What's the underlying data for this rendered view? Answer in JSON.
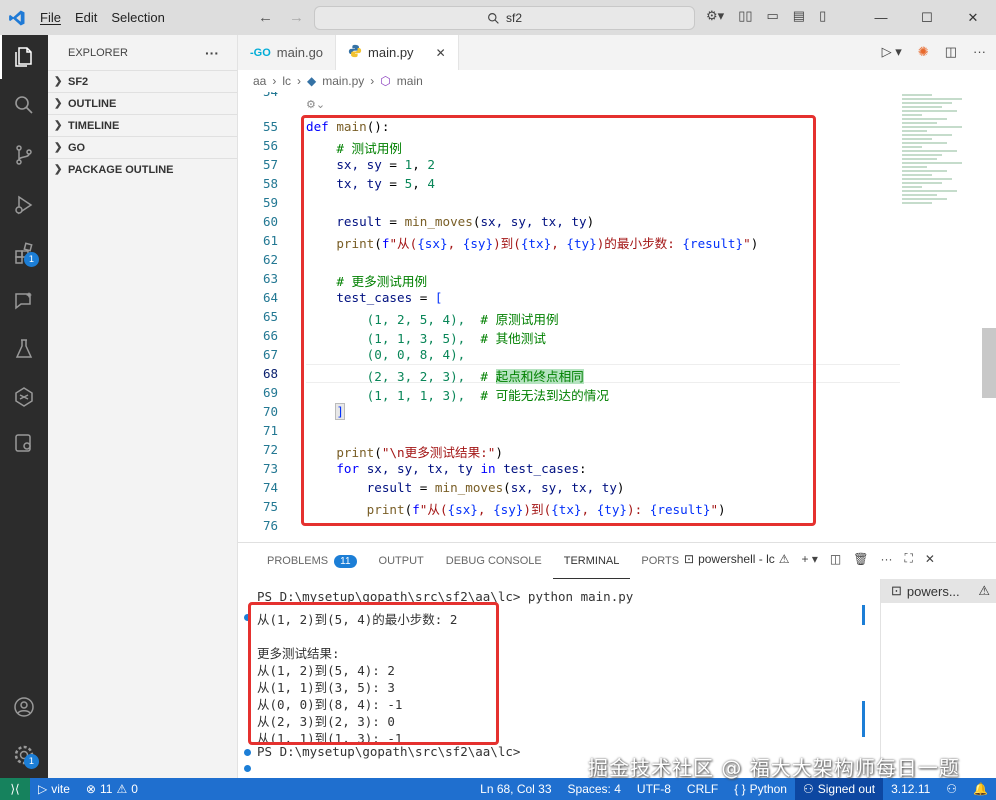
{
  "titlebar": {
    "menu": [
      "File",
      "Edit",
      "Selection"
    ],
    "search_text": "sf2",
    "nav_back": "←",
    "nav_forward": "→"
  },
  "sidebar": {
    "title": "EXPLORER",
    "more": "···",
    "sections": [
      "SF2",
      "OUTLINE",
      "TIMELINE",
      "GO",
      "PACKAGE OUTLINE"
    ]
  },
  "activity_badges": {
    "extensions": "1",
    "settings": "1"
  },
  "tabs": [
    {
      "label": "main.go",
      "icon": "go-file-icon"
    },
    {
      "label": "main.py",
      "icon": "python-file-icon"
    }
  ],
  "breadcrumb": [
    "aa",
    "lc",
    "main.py",
    "main"
  ],
  "editor": {
    "first_line_partial": "54",
    "line_numbers": [
      "55",
      "56",
      "57",
      "58",
      "59",
      "60",
      "61",
      "62",
      "63",
      "64",
      "65",
      "66",
      "67",
      "68",
      "69",
      "70",
      "71",
      "72",
      "73",
      "74",
      "75",
      "76"
    ],
    "current_line": "68",
    "code": {
      "l55_kw": "def",
      "l55_fn": "main",
      "l55_rest": "():",
      "l56": "# 测试用例",
      "l57_vars": "sx, sy",
      "l57_eq": " = ",
      "l57_n1": "1",
      "l57_n2": "2",
      "l58_vars": "tx, ty",
      "l58_n1": "5",
      "l58_n2": "4",
      "l60_var": "result",
      "l60_fn": "min_moves",
      "l60_args": "sx, sy, tx, ty",
      "l61_fn": "print",
      "l61_fstr_prefix": "f",
      "l61_s1": "\"从(",
      "l61_v1": "{sx}",
      "l61_s2": ", ",
      "l61_v2": "{sy}",
      "l61_s3": ")到(",
      "l61_v3": "{tx}",
      "l61_v4": "{ty}",
      "l61_s4": ")的最小步数: ",
      "l61_v5": "{result}",
      "l61_s5": "\"",
      "l63": "# 更多测试用例",
      "l64_var": "test_cases",
      "l65_tuple": "(1, 2, 5, 4),",
      "l65_cm": "# 原测试用例",
      "l66_tuple": "(1, 1, 3, 5),",
      "l66_cm": "# 其他测试",
      "l67_tuple": "(0, 0, 8, 4),",
      "l68_tuple": "(2, 3, 2, 3),",
      "l68_cm_pre": "# ",
      "l68_cm_hl": "起点和终点相同",
      "l69_tuple": "(1, 1, 1, 3),",
      "l69_cm": "# 可能无法到达的情况",
      "l70": "]",
      "l72_fn": "print",
      "l72_str": "\"\\n更多测试结果:\"",
      "l73_kw1": "for",
      "l73_vars": "sx, sy, tx, ty",
      "l73_kw2": "in",
      "l73_iter": "test_cases",
      "l74_var": "result",
      "l74_fn": "min_moves",
      "l74_args": "sx, sy, tx, ty",
      "l75_fn": "print",
      "l75_s3": ")到(",
      "l75_s4": "): "
    }
  },
  "panel": {
    "tabs": [
      "PROBLEMS",
      "OUTPUT",
      "DEBUG CONSOLE",
      "TERMINAL",
      "PORTS"
    ],
    "problems_count": "11",
    "shell_label": "powershell - lc",
    "terminal_list_item": "powers...",
    "terminal_lines": [
      "PS D:\\mysetup\\gopath\\src\\sf2\\aa\\lc> python main.py",
      "从(1, 2)到(5, 4)的最小步数: 2",
      "",
      "更多测试结果:",
      "从(1, 2)到(5, 4): 2",
      "从(1, 1)到(3, 5): 3",
      "从(0, 0)到(8, 4): -1",
      "从(2, 3)到(2, 3): 0",
      "从(1, 1)到(1, 3): -1",
      "PS D:\\mysetup\\gopath\\src\\sf2\\aa\\lc> "
    ]
  },
  "statusbar": {
    "vite": "vite",
    "errors": "11",
    "warnings": "0",
    "position": "Ln 68, Col 33",
    "spaces": "Spaces: 4",
    "encoding": "UTF-8",
    "eol": "CRLF",
    "language": "Python",
    "account": "Signed out",
    "python_version": "3.12.11"
  },
  "watermark": "掘金技术社区 @ 福大大架构师每日一题",
  "colors": {
    "accent": "#1f6fcf",
    "highlight_box": "#e5312f",
    "activity_bar": "#2c2c2c"
  }
}
